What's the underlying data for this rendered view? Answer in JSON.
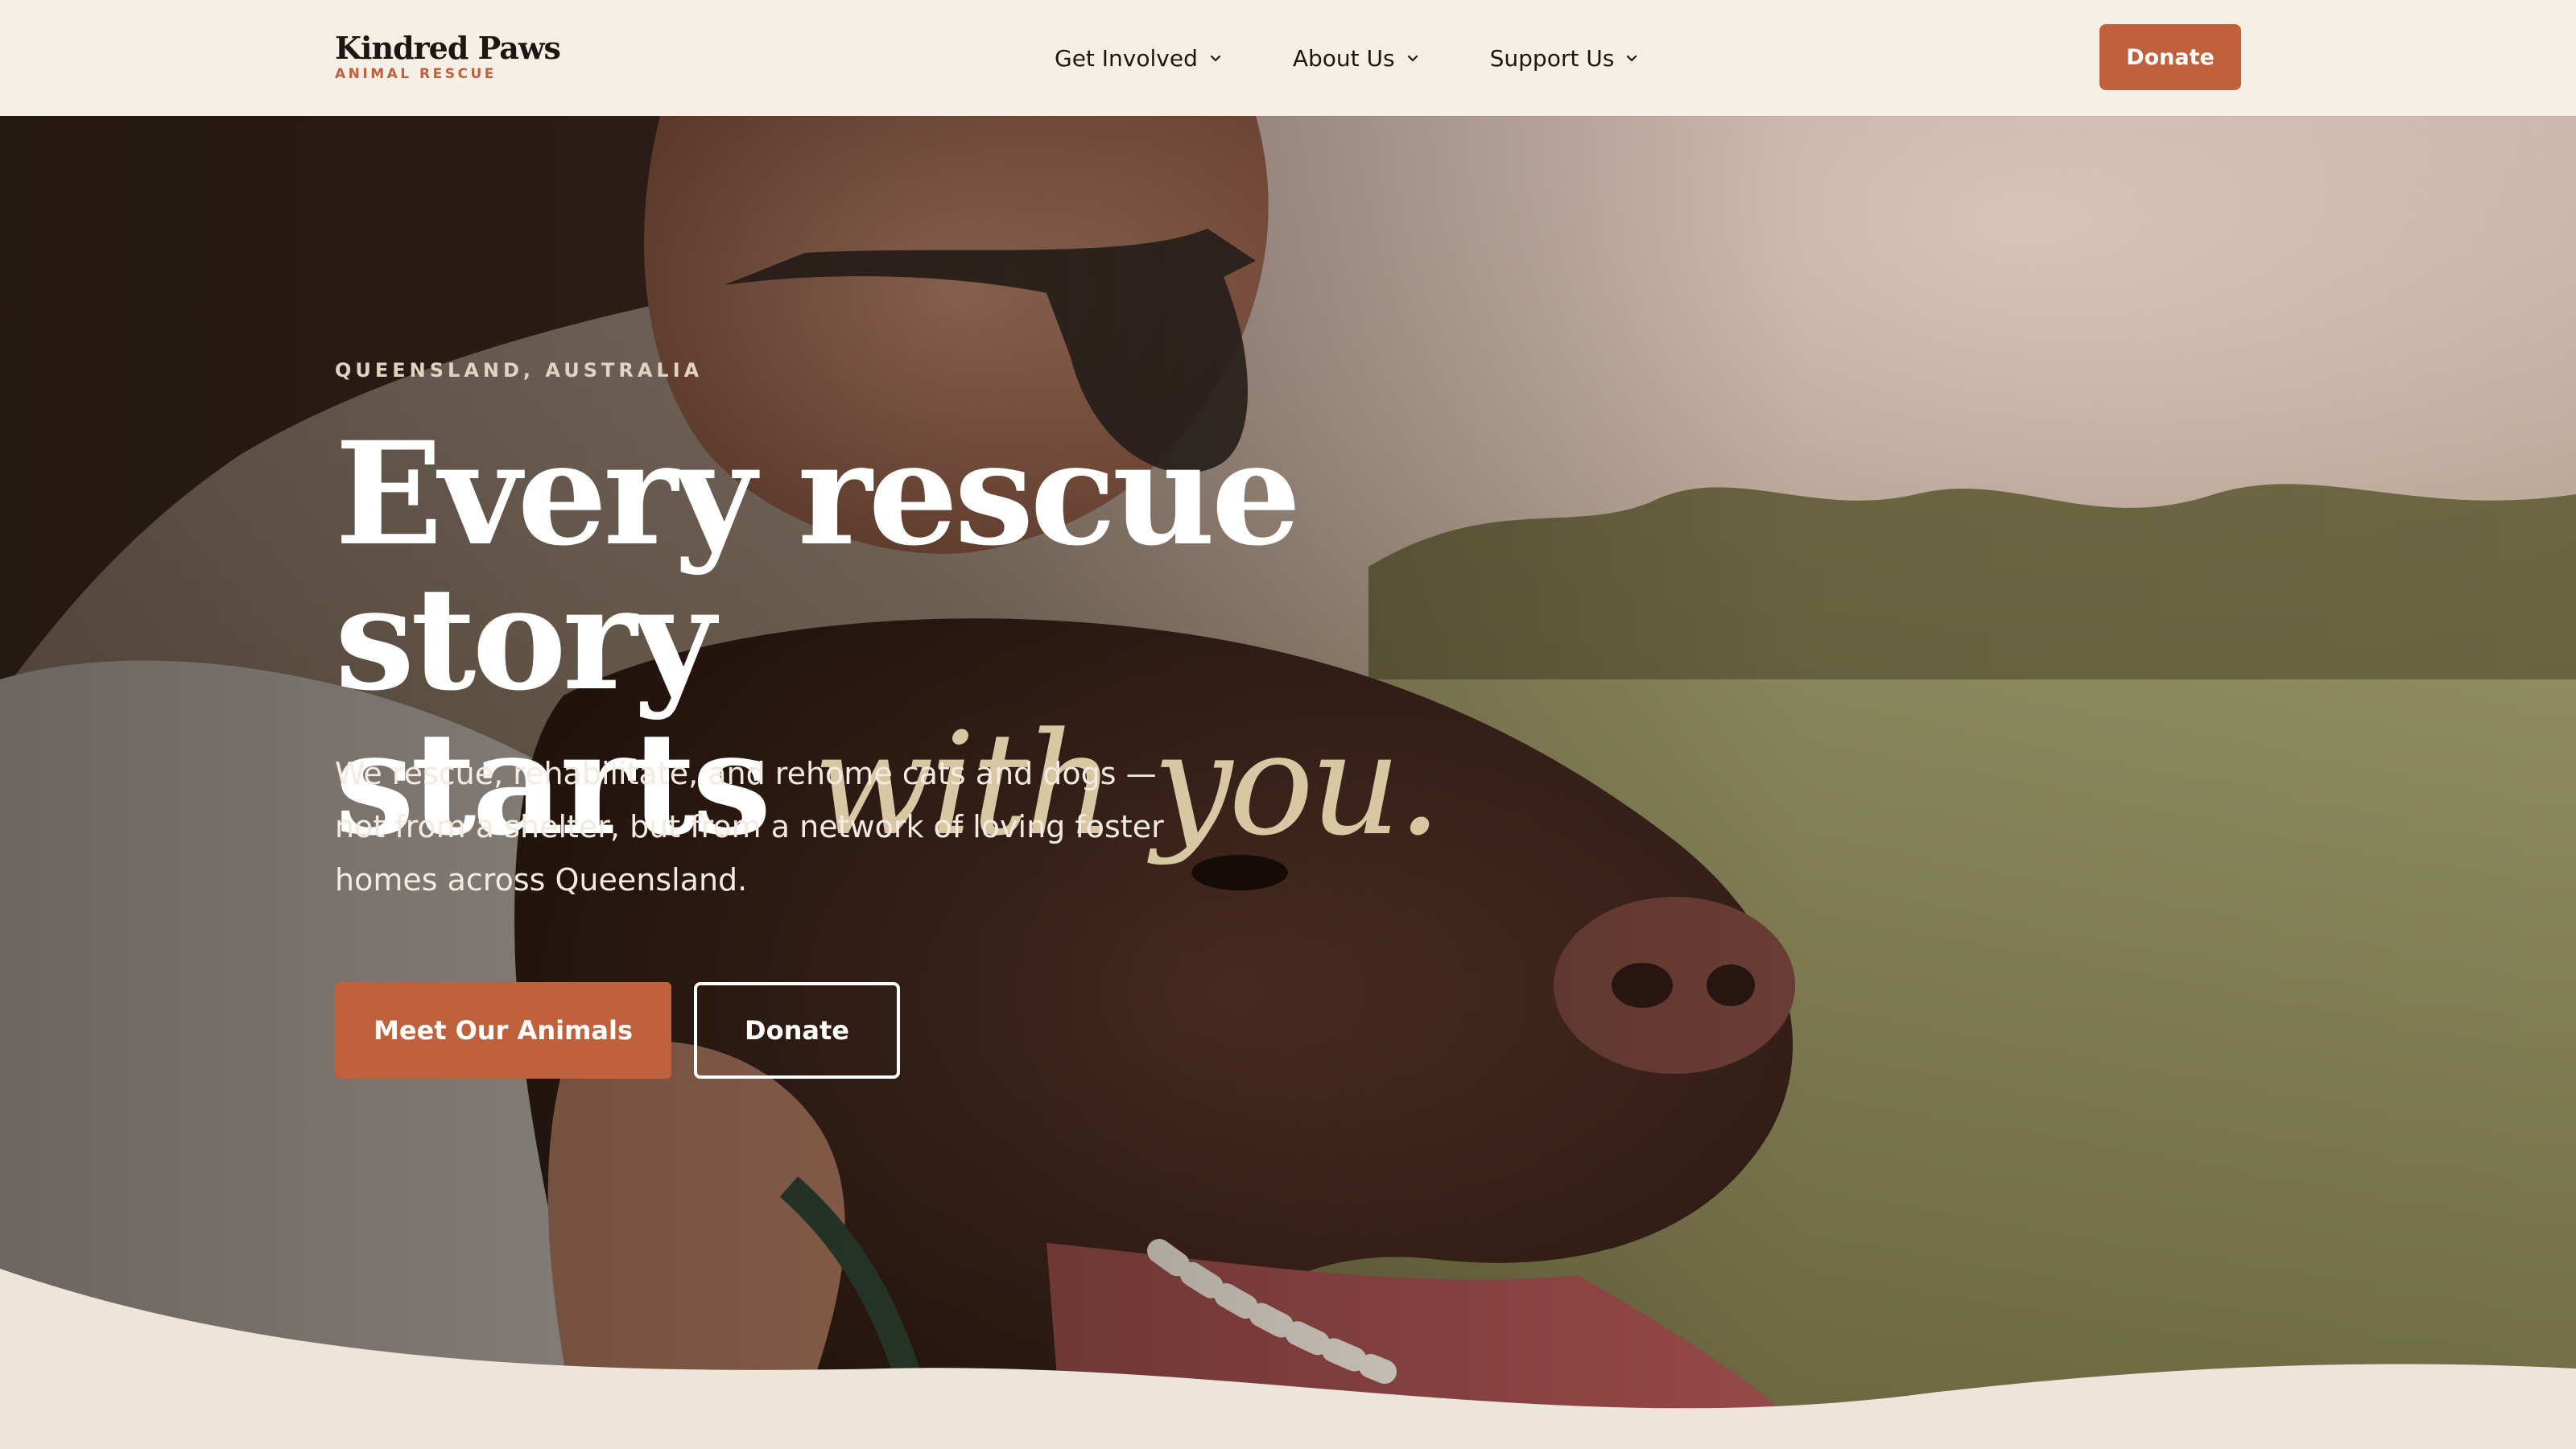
{
  "header": {
    "logo_title": "Kindred Paws",
    "logo_subtitle": "ANIMAL RESCUE",
    "nav": [
      {
        "label": "Get Involved",
        "icon": "chevron-down-icon"
      },
      {
        "label": "About Us",
        "icon": "chevron-down-icon"
      },
      {
        "label": "Support Us",
        "icon": "chevron-down-icon"
      }
    ],
    "donate_label": "Donate"
  },
  "hero": {
    "eyebrow": "QUEENSLAND, AUSTRALIA",
    "headline_line1": "Every rescue story",
    "headline_line2_plain": "starts",
    "headline_line2_accent": "with you.",
    "description": "We rescue, rehabilitate, and rehome cats and dogs — not from a shelter, but from a network of loving foster homes across Queensland.",
    "primary_cta": "Meet Our Animals",
    "secondary_cta": "Donate"
  },
  "colors": {
    "accent": "#c1603c",
    "header_bg": "#f5efe6",
    "page_bg": "#ede5da",
    "headline_accent": "#d9c6a3"
  }
}
